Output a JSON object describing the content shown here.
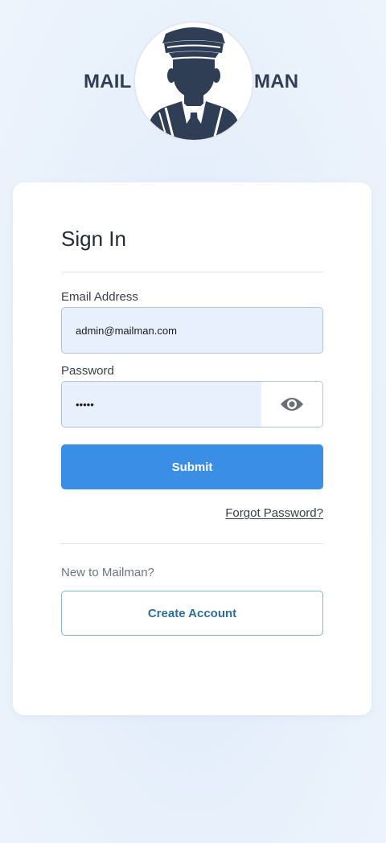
{
  "brand": {
    "left_text": "MAIL",
    "right_text": "MAN",
    "logo_icon": "mailman-avatar-icon",
    "text_color": "#2f3d55"
  },
  "signin": {
    "title": "Sign In",
    "email_label": "Email Address",
    "email_value": "admin@mailman.com",
    "password_label": "Password",
    "password_value": "•••••",
    "toggle_icon": "eye-icon",
    "submit_label": "Submit",
    "forgot_label": "Forgot Password?",
    "new_prompt": "New to Mailman?",
    "create_label": "Create Account"
  },
  "colors": {
    "primary": "#3a8ee6",
    "input_bg": "#e8effd",
    "secondary_text": "#2e6f9a"
  }
}
